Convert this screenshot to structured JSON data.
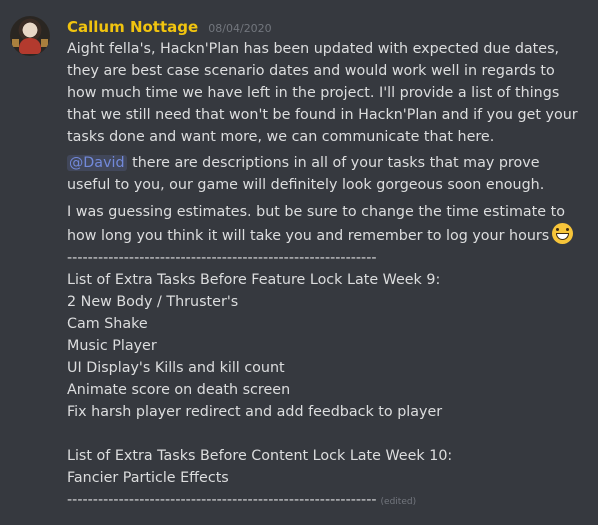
{
  "header": {
    "username": "Callum Nottage",
    "timestamp": "08/04/2020"
  },
  "message": {
    "paragraph1": [
      "Aight fella's, Hackn'Plan has been updated with expected due dates,",
      "they are best case scenario dates and would work well in regards to",
      "how much time we have left in the project. I'll provide a list of things",
      "that we still need that won't be found in Hackn'Plan and if you get your",
      "tasks done and want more, we can communicate that here."
    ],
    "mention": "@David",
    "paragraph2_line1_rest": " there are descriptions in all of your tasks that may prove",
    "paragraph2_line2": "useful to you, our game will definitely look gorgeous soon enough.",
    "paragraph3_line1": "I was guessing estimates. but be sure to change the time estimate to",
    "paragraph3_line2": "how long you think it will take you and remember to log your hours",
    "emoji": "grinning-face-with-smiling-eyes",
    "divider": "------------------------------------------------------------",
    "list1": {
      "heading": "List of Extra Tasks Before Feature Lock Late Week 9:",
      "items": [
        "2 New Body / Thruster's",
        "Cam Shake",
        "Music Player",
        "UI Display's Kills and kill count",
        "Animate score on death screen",
        "Fix harsh player redirect and add feedback to player"
      ]
    },
    "list2": {
      "heading": "List of Extra Tasks Before Content Lock Late Week 10:",
      "items": [
        "Fancier Particle Effects"
      ]
    },
    "divider_end": "------------------------------------------------------------",
    "edited_label": "(edited)"
  },
  "colors": {
    "background": "#36393f",
    "username": "#f1c40f",
    "text": "#dcddde",
    "muted": "#72767d",
    "mention": "#7289da"
  }
}
